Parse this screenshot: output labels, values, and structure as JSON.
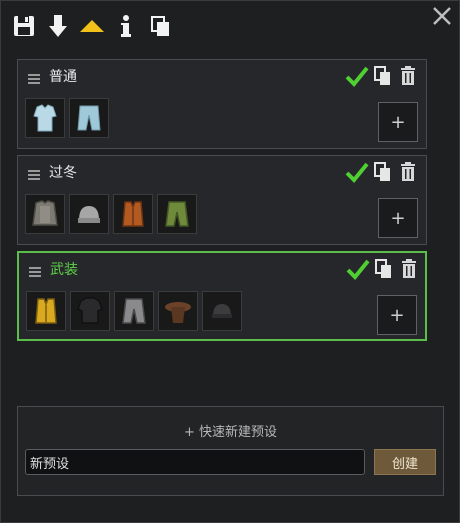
{
  "window": {
    "toolbar": [
      {
        "icon": "save-icon"
      },
      {
        "icon": "import-arrow-down-icon"
      },
      {
        "icon": "collapse-up-arrow-icon",
        "color": "#f2c21a"
      },
      {
        "icon": "info-icon"
      },
      {
        "icon": "copy-clipboard-icon"
      }
    ],
    "close_icon": "close-icon"
  },
  "presets": [
    {
      "name": "普通",
      "selected": false,
      "name_color": "#e8e8e8",
      "items": [
        {
          "icon": "light-blue-shirt-icon"
        },
        {
          "icon": "light-blue-pants-icon"
        }
      ],
      "add_label": "+"
    },
    {
      "name": "过冬",
      "selected": false,
      "name_color": "#e8e8e8",
      "items": [
        {
          "icon": "grey-parka-icon"
        },
        {
          "icon": "grey-tuque-hat-icon"
        },
        {
          "icon": "orange-vest-icon"
        },
        {
          "icon": "green-pants-icon"
        }
      ],
      "add_label": "+"
    },
    {
      "name": "武装",
      "selected": true,
      "name_color": "#5fd14a",
      "items": [
        {
          "icon": "yellow-vest-icon"
        },
        {
          "icon": "black-armor-vest-icon"
        },
        {
          "icon": "grey-armor-pants-icon"
        },
        {
          "icon": "brown-cowboy-hat-icon"
        },
        {
          "icon": "dark-helmet-icon"
        }
      ],
      "add_label": "+"
    }
  ],
  "quick_create": {
    "title": "+ 快速新建预设",
    "input_value": "新预设",
    "button_label": "创建"
  },
  "colors": {
    "accent_green": "#5bbd4a",
    "create_button": "#6e5a3a"
  }
}
